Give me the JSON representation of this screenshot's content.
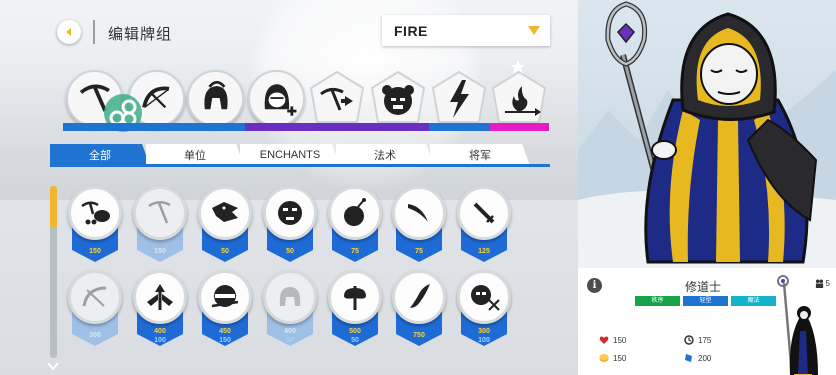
{
  "header": {
    "title": "编辑牌组",
    "deck_dropdown": "FIRE"
  },
  "deck_slots": [
    {
      "icon": "pickaxe-icon"
    },
    {
      "icon": "bow-icon"
    },
    {
      "icon": "spartan-helmet-icon"
    },
    {
      "icon": "hooded-add-icon"
    },
    {
      "icon": "pickaxe-arrow-icon"
    },
    {
      "icon": "angry-bear-icon"
    },
    {
      "icon": "lightning-icon"
    },
    {
      "icon": "fire-arrow-icon"
    }
  ],
  "tabs": [
    {
      "label": "全部",
      "active": true
    },
    {
      "label": "单位",
      "active": false
    },
    {
      "label": "ENCHANTS",
      "active": false
    },
    {
      "label": "法术",
      "active": false
    },
    {
      "label": "将军",
      "active": false
    }
  ],
  "cards_row1": [
    {
      "icon": "miner-cart-icon",
      "cost": "150",
      "dim": false
    },
    {
      "icon": "pickaxe-icon",
      "cost": "150",
      "dim": true
    },
    {
      "icon": "dragon-head-icon",
      "cost": "50",
      "dim": false
    },
    {
      "icon": "stick-head-icon",
      "cost": "50",
      "dim": false
    },
    {
      "icon": "bomb-icon",
      "cost": "75",
      "dim": false
    },
    {
      "icon": "scythe-icon",
      "cost": "75",
      "dim": false
    },
    {
      "icon": "sword-icon",
      "cost": "125",
      "dim": false
    }
  ],
  "cards_row2": [
    {
      "icon": "bow-icon",
      "cost": "300",
      "cost2": "",
      "dim": true
    },
    {
      "icon": "winged-arrow-icon",
      "cost": "400",
      "cost2": "100",
      "dim": false
    },
    {
      "icon": "ninja-head-icon",
      "cost": "450",
      "cost2": "150",
      "dim": false
    },
    {
      "icon": "helmet-icon",
      "cost": "400",
      "cost2": "50",
      "dim": true
    },
    {
      "icon": "axe-icon",
      "cost": "500",
      "cost2": "50",
      "dim": false
    },
    {
      "icon": "flame-blade-icon",
      "cost": "750",
      "cost2": "",
      "dim": false
    },
    {
      "icon": "skull-crossbones-icon",
      "cost": "300",
      "cost2": "100",
      "dim": false
    }
  ],
  "unit": {
    "name": "修道士",
    "population": "5",
    "tags": [
      {
        "label": "秩序",
        "color": "#17a34a"
      },
      {
        "label": "轻型",
        "color": "#1f74d2"
      },
      {
        "label": "魔法",
        "color": "#14b3c9"
      }
    ],
    "health": "150",
    "cooldown": "175",
    "gold": "150",
    "mana": "200"
  },
  "colors": {
    "accent": "#1f74d2",
    "gold": "#f2b52e",
    "purple": "#6a2fc0",
    "magenta": "#e81cc7"
  }
}
